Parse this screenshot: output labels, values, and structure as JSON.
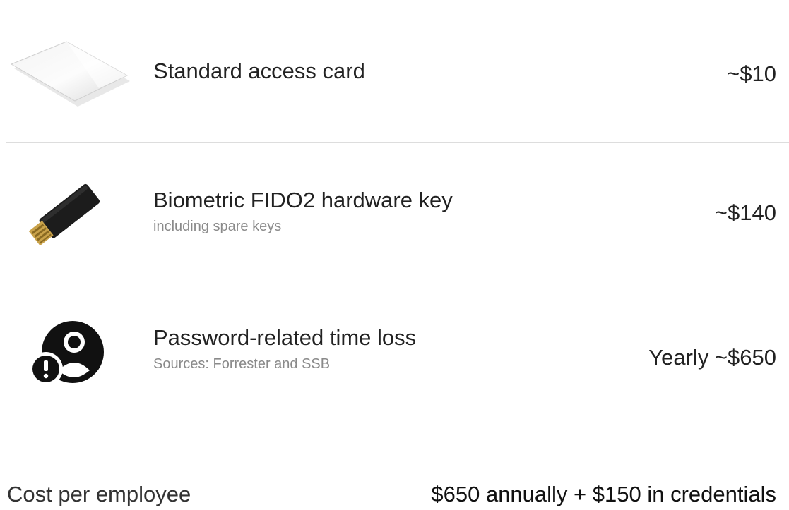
{
  "items": [
    {
      "title": "Standard access card",
      "subtitle": "",
      "price": "~$10",
      "icon": "access-card-icon"
    },
    {
      "title": "Biometric FIDO2 hardware key",
      "subtitle": "including spare keys",
      "price": "~$140",
      "icon": "usb-key-icon"
    },
    {
      "title": "Password-related time loss",
      "subtitle": "Sources: Forrester and SSB",
      "price": "Yearly ~$650",
      "icon": "user-alert-icon"
    }
  ],
  "summary": {
    "label": "Cost per employee",
    "value": "$650 annually + $150 in credentials"
  },
  "colors": {
    "text": "#222222",
    "subtext": "#8a8a8a",
    "divider": "#dddddd"
  }
}
